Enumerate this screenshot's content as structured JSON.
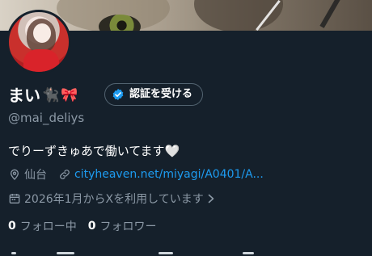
{
  "profile": {
    "display_name": "まい",
    "name_emojis": [
      "🐈‍⬛",
      "🎀"
    ],
    "handle": "@mai_deliys",
    "verify_button_label": "認証を受ける",
    "bio": "でりーずきゅあで働いてます🤍",
    "location": "仙台",
    "link": "cityheaven.net/miyagi/A0401/A...",
    "joined": "2026年1月からXを利用しています",
    "following_count": "0",
    "following_label": "フォロー中",
    "followers_count": "0",
    "followers_label": "フォロワー"
  },
  "icons": {
    "verify": "verified-badge-icon",
    "location": "location-pin-icon",
    "link": "link-icon",
    "calendar": "calendar-icon",
    "chevron": "chevron-right-icon"
  },
  "colors": {
    "background": "#15202b",
    "accent": "#1d9bf0",
    "secondary_text": "#8b98a5",
    "border": "#536471"
  }
}
